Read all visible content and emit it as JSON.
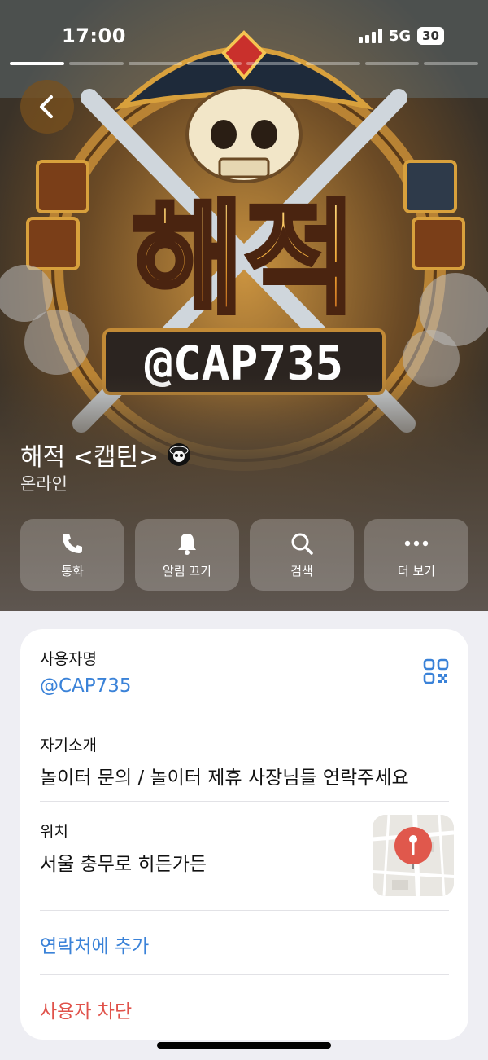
{
  "status_bar": {
    "time": "17:00",
    "network": "5G",
    "battery": "30"
  },
  "hero": {
    "banner_title": "해적",
    "banner_handle": "@CAP735"
  },
  "profile": {
    "name": "해적 <캡틴>",
    "status": "온라인"
  },
  "actions": [
    {
      "label": "통화",
      "icon": "phone-icon"
    },
    {
      "label": "알림 끄기",
      "icon": "bell-icon"
    },
    {
      "label": "검색",
      "icon": "search-icon"
    },
    {
      "label": "더 보기",
      "icon": "more-icon"
    }
  ],
  "info": {
    "username_label": "사용자명",
    "username_value": "@CAP735",
    "bio_label": "자기소개",
    "bio_value": "놀이터 문의 / 놀이터 제휴 사장님들 연락주세요",
    "location_label": "위치",
    "location_value": "서울 충무로 히든가든",
    "add_contact": "연락처에 추가",
    "block_user": "사용자 차단"
  },
  "colors": {
    "link_blue": "#3a82d8",
    "danger_red": "#e0524a",
    "card_bg": "#ffffff",
    "page_bg": "#eeeef3"
  }
}
